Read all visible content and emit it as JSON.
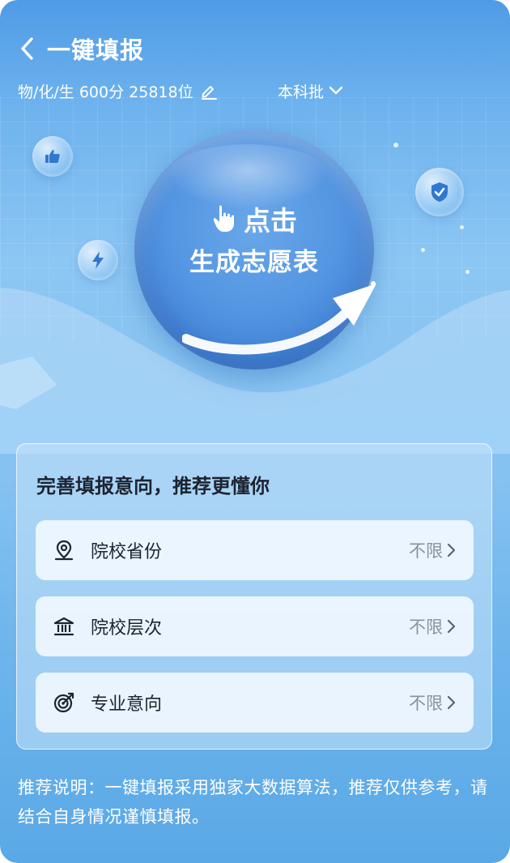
{
  "header": {
    "title": "一键填报",
    "back_icon": "chevron-left-icon"
  },
  "subbar": {
    "scores": "物/化/生 600分 25818位",
    "edit_icon": "pencil-icon",
    "batch": "本科批",
    "batch_icon": "chevron-down-icon"
  },
  "hero": {
    "line1": "点击",
    "line2": "生成志愿表",
    "hand_icon": "pointing-hand-icon",
    "decor_icons": [
      "thumbs-up-icon",
      "lightning-icon",
      "shield-check-icon"
    ]
  },
  "card": {
    "title": "完善填报意向，推荐更懂你",
    "rows": [
      {
        "label": "院校省份",
        "value": "不限",
        "icon": "location-pin-icon"
      },
      {
        "label": "院校层次",
        "value": "不限",
        "icon": "institution-icon"
      },
      {
        "label": "专业意向",
        "value": "不限",
        "icon": "target-icon"
      }
    ]
  },
  "note": "推荐说明：一键填报采用独家大数据算法，推荐仅供参考，请结合自身情况谨慎填报。",
  "colors": {
    "accent_blue": "#4f9be6",
    "bubble_blue": "#4a8ddd",
    "text_dark": "#1c2330",
    "text_muted": "#8a929c"
  }
}
